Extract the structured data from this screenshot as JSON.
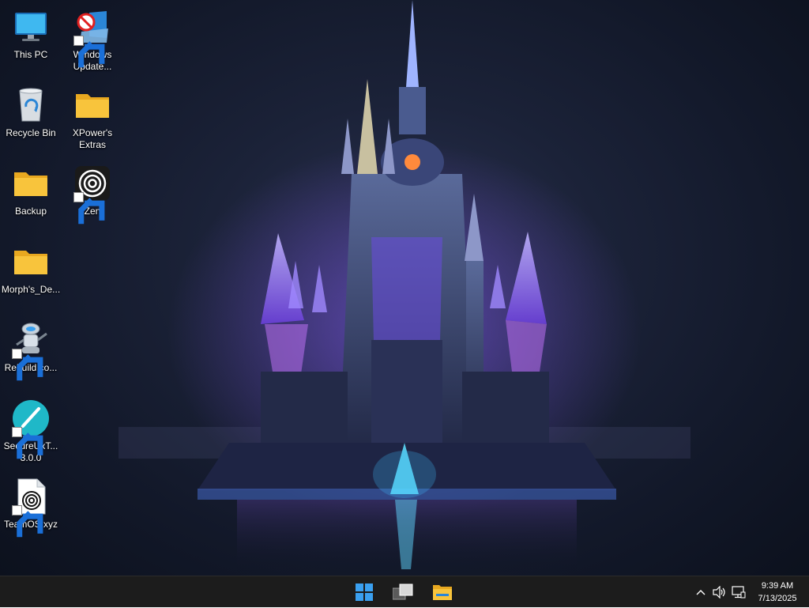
{
  "desktop": {
    "icons": [
      {
        "label": "This PC",
        "icon": "monitor-icon"
      },
      {
        "label": "Windows Update...",
        "icon": "windows-update-icon",
        "shortcut": true
      },
      {
        "label": "Recycle Bin",
        "icon": "recycle-bin-icon"
      },
      {
        "label": "XPower's Extras",
        "icon": "folder-icon"
      },
      {
        "label": "Backup",
        "icon": "folder-icon"
      },
      {
        "label": "Zen",
        "icon": "zen-icon",
        "shortcut": true
      },
      {
        "label": "Morph's_De...",
        "icon": "folder-icon"
      },
      {
        "label": "RebuildIco...",
        "icon": "robot-icon",
        "shortcut": true
      },
      {
        "label": "SecureUxT... 3.0.0",
        "icon": "secureux-icon",
        "shortcut": true
      },
      {
        "label": "TeamOS.xyz",
        "icon": "file-icon",
        "shortcut": true
      }
    ]
  },
  "taskbar": {
    "apps": [
      {
        "name": "start",
        "icon": "windows-start-icon"
      },
      {
        "name": "task-view",
        "icon": "task-view-icon"
      },
      {
        "name": "file-explorer",
        "icon": "file-explorer-icon"
      }
    ],
    "tray": {
      "icons": [
        "chevron-up-icon",
        "volume-icon",
        "network-icon"
      ],
      "time": "9:39 AM",
      "date": "7/13/2025"
    }
  },
  "colors": {
    "taskbar_bg": "#1c1c1c",
    "folder_yellow": "#f8c43c",
    "accent_blue": "#3aa0f0"
  }
}
